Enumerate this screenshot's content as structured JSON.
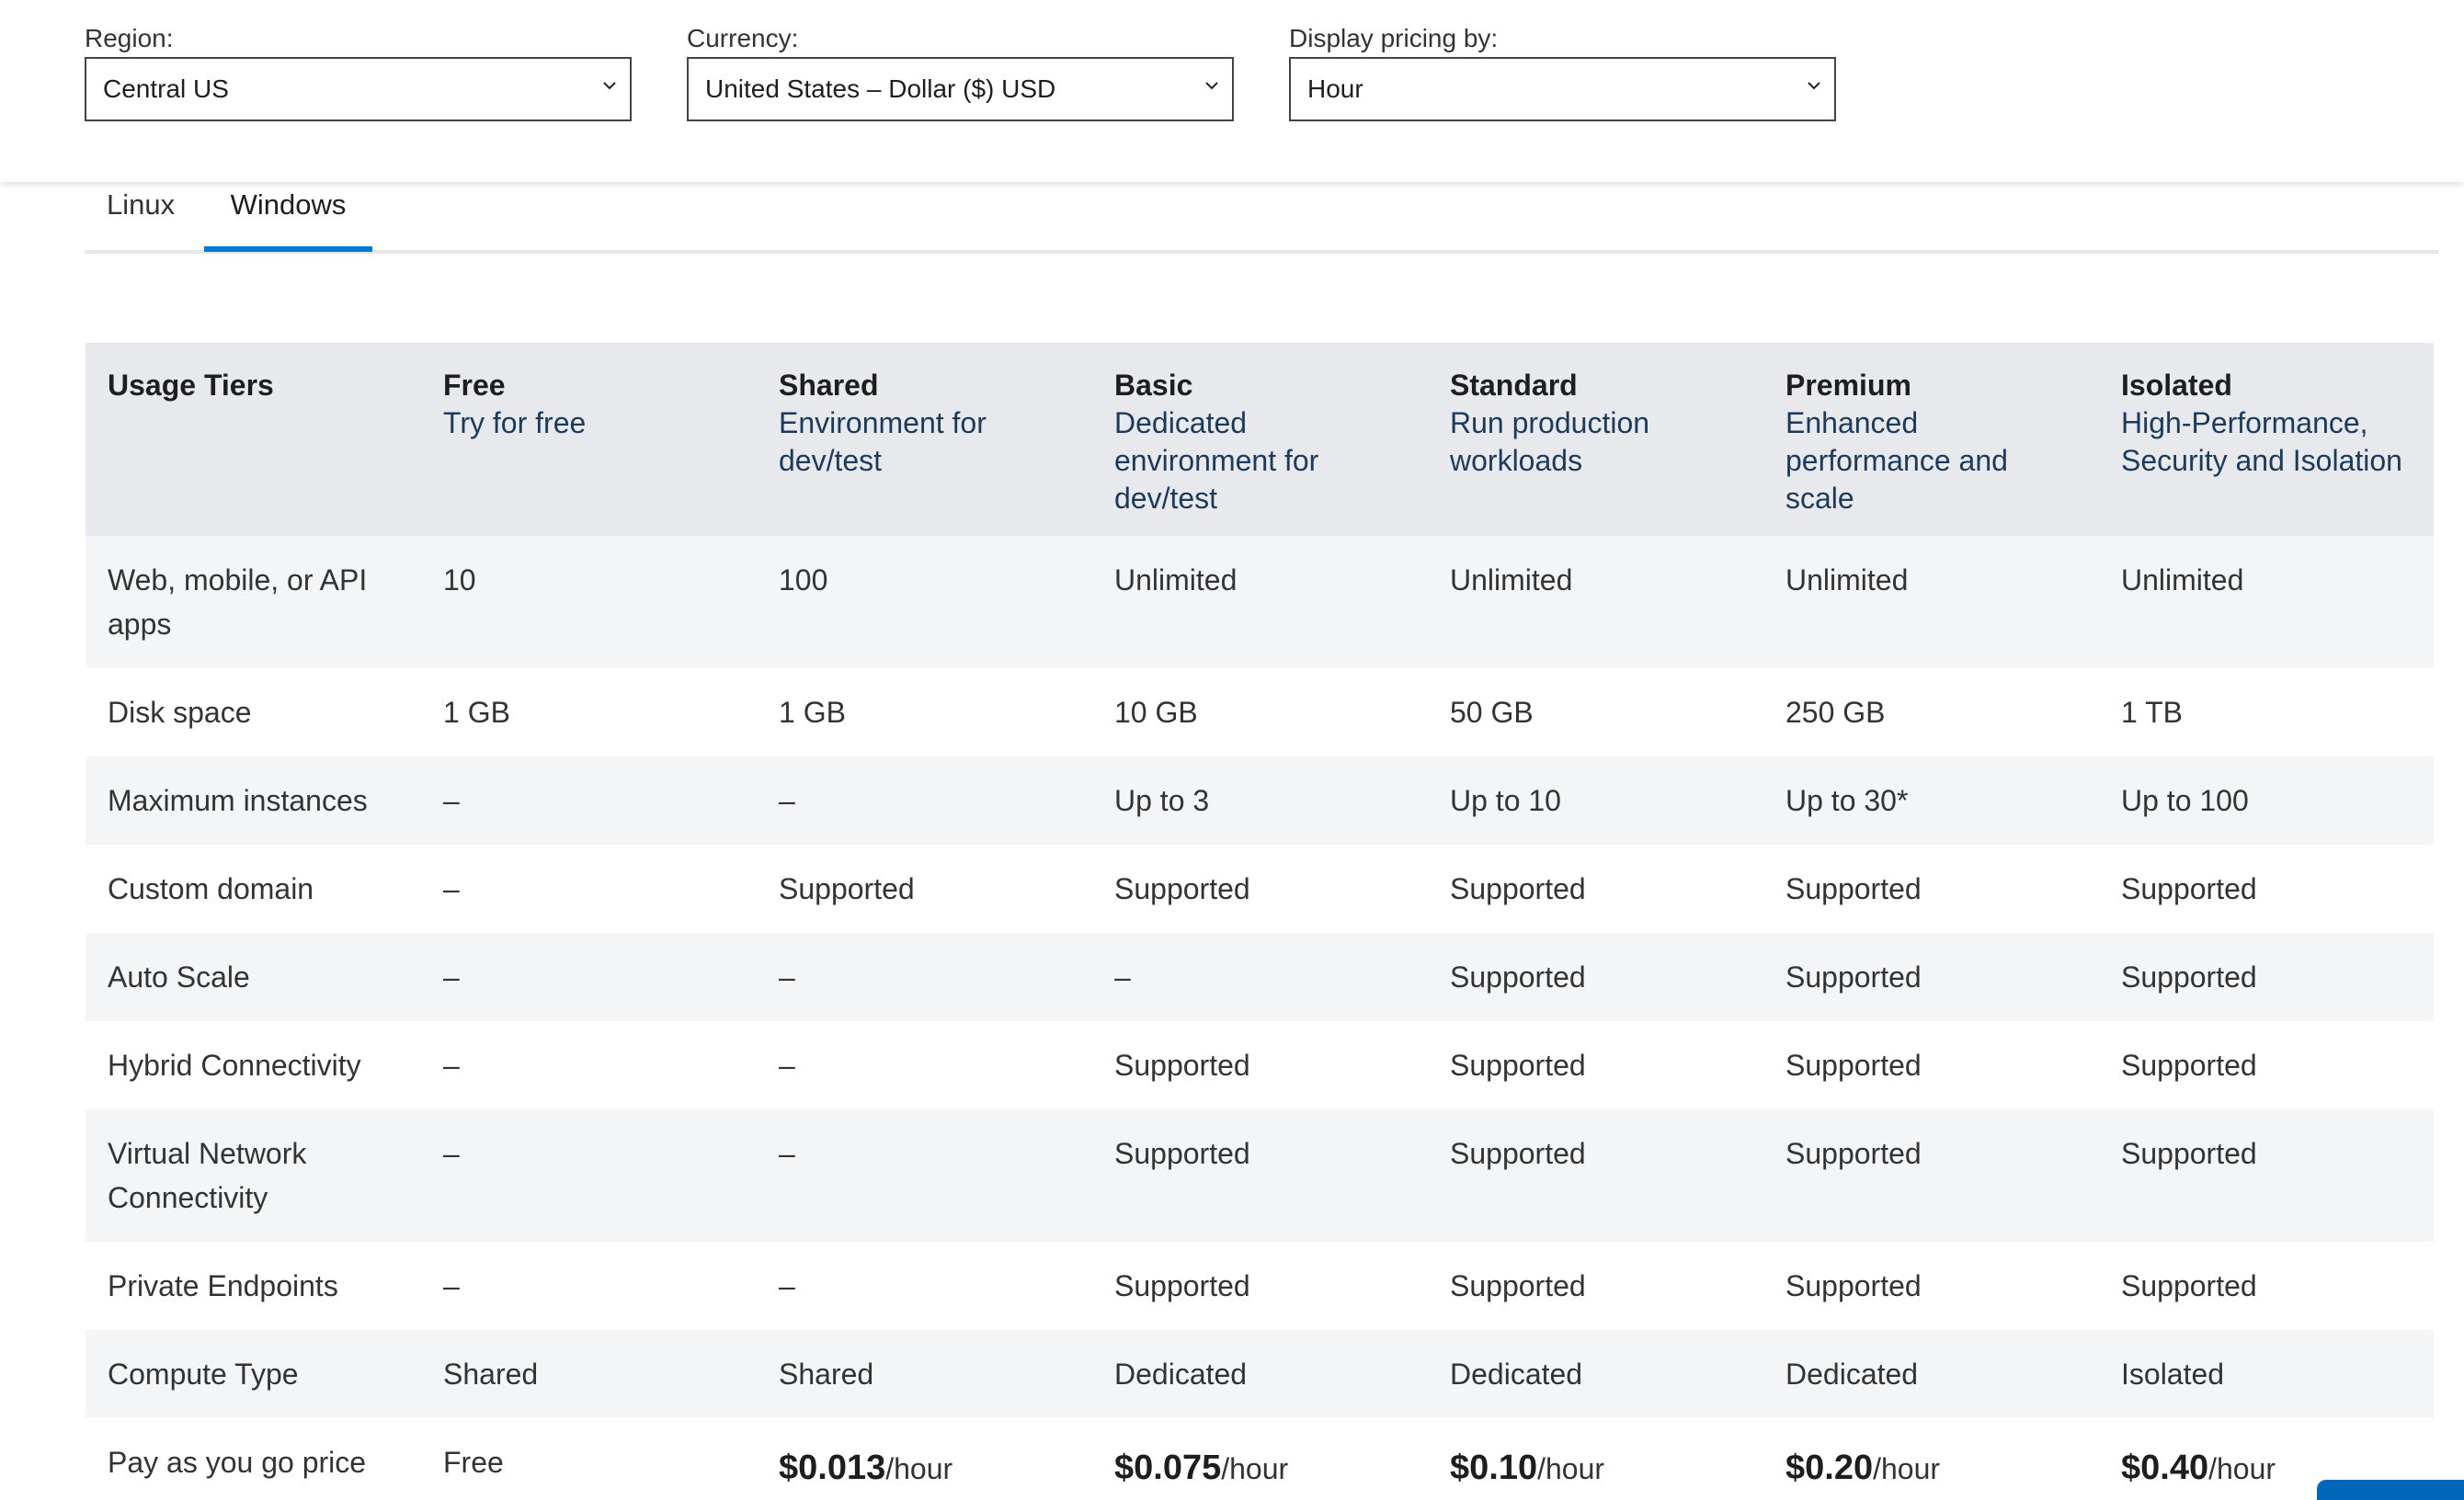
{
  "filters": {
    "region": {
      "label": "Region:",
      "value": "Central US"
    },
    "currency": {
      "label": "Currency:",
      "value": "United States – Dollar ($) USD"
    },
    "display": {
      "label": "Display pricing by:",
      "value": "Hour"
    }
  },
  "tabs": [
    {
      "label": "Linux"
    },
    {
      "label": "Windows"
    }
  ],
  "colors": {
    "accent": "#0078d4",
    "header_bg": "#e8e9ec",
    "stripe_bg": "#f4f5f6",
    "header_desc": "#1b3a5c"
  },
  "table": {
    "headers": [
      {
        "name": "Usage Tiers",
        "desc": ""
      },
      {
        "name": "Free",
        "desc": "Try for free"
      },
      {
        "name": "Shared",
        "desc": "Environment for dev/test"
      },
      {
        "name": "Basic",
        "desc": "Dedicated environment for dev/test"
      },
      {
        "name": "Standard",
        "desc": "Run production workloads"
      },
      {
        "name": "Premium",
        "desc": "Enhanced performance and scale"
      },
      {
        "name": "Isolated",
        "desc": "High-Performance, Security and Isolation"
      }
    ],
    "rows": [
      {
        "label": "Web, mobile, or API apps",
        "cells": [
          "10",
          "100",
          "Unlimited",
          "Unlimited",
          "Unlimited",
          "Unlimited"
        ]
      },
      {
        "label": "Disk space",
        "cells": [
          "1 GB",
          "1 GB",
          "10 GB",
          "50 GB",
          "250 GB",
          "1 TB"
        ]
      },
      {
        "label": "Maximum instances",
        "cells": [
          "–",
          "–",
          "Up to 3",
          "Up to 10",
          "Up to 30*",
          "Up to 100"
        ]
      },
      {
        "label": "Custom domain",
        "cells": [
          "–",
          "Supported",
          "Supported",
          "Supported",
          "Supported",
          "Supported"
        ]
      },
      {
        "label": "Auto Scale",
        "cells": [
          "–",
          "–",
          "–",
          "Supported",
          "Supported",
          "Supported"
        ]
      },
      {
        "label": "Hybrid Connectivity",
        "cells": [
          "–",
          "–",
          "Supported",
          "Supported",
          "Supported",
          "Supported"
        ]
      },
      {
        "label": "Virtual Network Connectivity",
        "cells": [
          "–",
          "–",
          "Supported",
          "Supported",
          "Supported",
          "Supported"
        ]
      },
      {
        "label": "Private Endpoints",
        "cells": [
          "–",
          "–",
          "Supported",
          "Supported",
          "Supported",
          "Supported"
        ]
      },
      {
        "label": "Compute Type",
        "cells": [
          "Shared",
          "Shared",
          "Dedicated",
          "Dedicated",
          "Dedicated",
          "Isolated"
        ]
      }
    ],
    "price_row": {
      "label": "Pay as you go price",
      "free": "Free",
      "prices": [
        {
          "amount": "$0.013",
          "unit": "/hour"
        },
        {
          "amount": "$0.075",
          "unit": "/hour"
        },
        {
          "amount": "$0.10",
          "unit": "/hour"
        },
        {
          "amount": "$0.20",
          "unit": "/hour"
        },
        {
          "amount": "$0.40",
          "unit": "/hour"
        }
      ]
    }
  }
}
